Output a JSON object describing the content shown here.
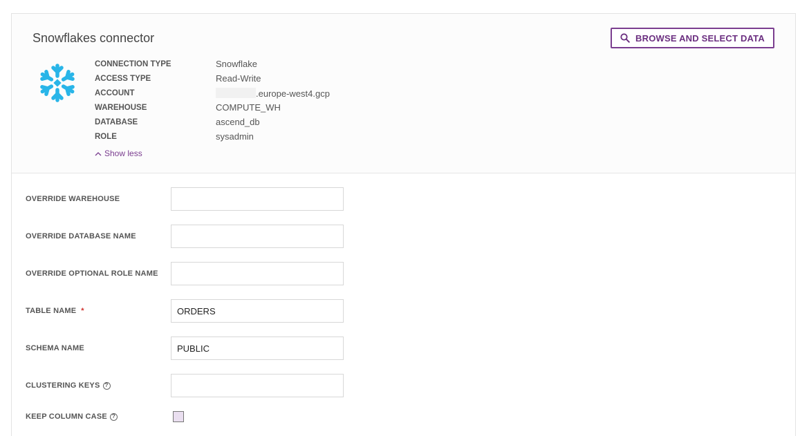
{
  "header": {
    "title": "Snowflakes connector",
    "browse_button": "BROWSE AND SELECT DATA",
    "show_less": "Show less",
    "logo_color": "#29b5e8"
  },
  "connection": [
    {
      "key": "CONNECTION TYPE",
      "value": "Snowflake"
    },
    {
      "key": "ACCESS TYPE",
      "value": "Read-Write"
    },
    {
      "key": "ACCOUNT",
      "value": ".europe-west4.gcp"
    },
    {
      "key": "WAREHOUSE",
      "value": "COMPUTE_WH"
    },
    {
      "key": "DATABASE",
      "value": "ascend_db"
    },
    {
      "key": "ROLE",
      "value": "sysadmin"
    }
  ],
  "form": {
    "override_warehouse": {
      "label": "OVERRIDE WAREHOUSE",
      "value": ""
    },
    "override_database": {
      "label": "OVERRIDE DATABASE NAME",
      "value": ""
    },
    "override_role": {
      "label": "OVERRIDE OPTIONAL ROLE NAME",
      "value": ""
    },
    "table_name": {
      "label": "TABLE NAME",
      "required": "*",
      "value": "ORDERS"
    },
    "schema_name": {
      "label": "SCHEMA NAME",
      "value": "PUBLIC"
    },
    "clustering_keys": {
      "label": "CLUSTERING KEYS",
      "help": "?",
      "value": ""
    },
    "keep_column_case": {
      "label": "KEEP COLUMN CASE",
      "help": "?",
      "checked": false
    }
  },
  "colors": {
    "accent": "#7a3d8f",
    "required": "#d0312d"
  }
}
